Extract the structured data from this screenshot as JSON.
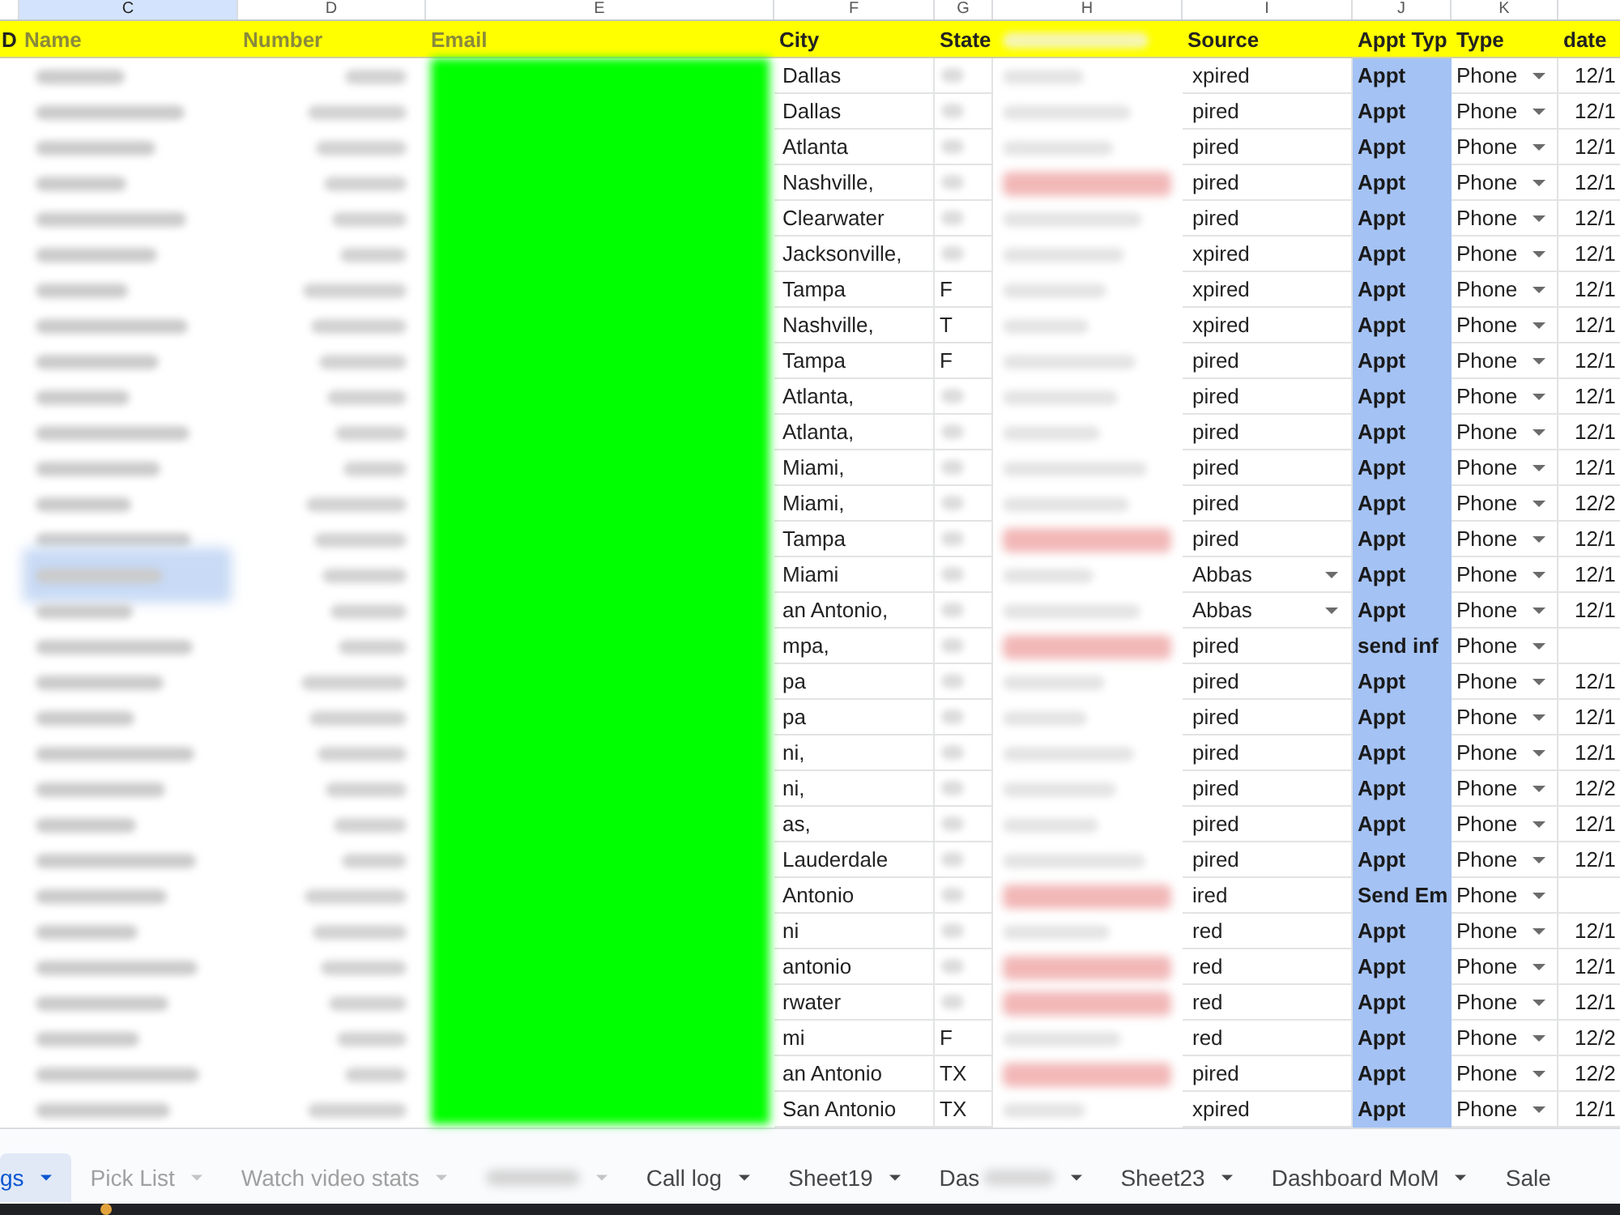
{
  "columns": [
    {
      "letter": "C",
      "selected": true
    },
    {
      "letter": "D",
      "selected": false
    },
    {
      "letter": "E",
      "selected": false
    },
    {
      "letter": "F",
      "selected": false
    },
    {
      "letter": "G",
      "selected": false
    },
    {
      "letter": "H",
      "selected": false
    },
    {
      "letter": "I",
      "selected": false
    },
    {
      "letter": "J",
      "selected": false
    },
    {
      "letter": "K",
      "selected": false
    }
  ],
  "headers": [
    {
      "label": "D",
      "kind": "text"
    },
    {
      "label": "Name",
      "kind": "faded"
    },
    {
      "label": "Number",
      "kind": "faded"
    },
    {
      "label": "Email",
      "kind": "faded"
    },
    {
      "label": "City",
      "kind": "text"
    },
    {
      "label": "State",
      "kind": "text"
    },
    {
      "kind": "redacted"
    },
    {
      "label": "Source",
      "kind": "text"
    },
    {
      "label": "Appt Typ",
      "kind": "text"
    },
    {
      "label": "Type",
      "kind": "text"
    },
    {
      "label": "date",
      "kind": "text"
    }
  ],
  "rows": [
    {
      "selected": false,
      "city": "Dallas",
      "marked": false,
      "source": "xpired",
      "menu": false,
      "appt": "Appt",
      "type": "Phone",
      "date": "12/1"
    },
    {
      "selected": false,
      "city": "Dallas",
      "marked": false,
      "source": "pired",
      "menu": false,
      "appt": "Appt",
      "type": "Phone",
      "date": "12/1"
    },
    {
      "selected": false,
      "city": "Atlanta",
      "marked": false,
      "source": "pired",
      "menu": false,
      "appt": "Appt",
      "type": "Phone",
      "date": "12/1"
    },
    {
      "selected": false,
      "city": "Nashville,",
      "marked": true,
      "source": "pired",
      "menu": false,
      "appt": "Appt",
      "type": "Phone",
      "date": "12/1"
    },
    {
      "selected": false,
      "city": "Clearwater",
      "marked": false,
      "source": "pired",
      "menu": false,
      "appt": "Appt",
      "type": "Phone",
      "date": "12/1"
    },
    {
      "selected": false,
      "city": "Jacksonville,",
      "marked": false,
      "source": "xpired",
      "menu": false,
      "appt": "Appt",
      "type": "Phone",
      "date": "12/1"
    },
    {
      "selected": false,
      "city": "Tampa",
      "state": "F",
      "marked": false,
      "source": "xpired",
      "menu": false,
      "appt": "Appt",
      "type": "Phone",
      "date": "12/1"
    },
    {
      "selected": false,
      "city": "Nashville,",
      "state": "T",
      "marked": false,
      "source": "xpired",
      "menu": false,
      "appt": "Appt",
      "type": "Phone",
      "date": "12/1"
    },
    {
      "selected": false,
      "city": "Tampa",
      "state": "F",
      "marked": false,
      "source": "pired",
      "menu": false,
      "appt": "Appt",
      "type": "Phone",
      "date": "12/1"
    },
    {
      "selected": false,
      "city": "Atlanta,",
      "marked": false,
      "source": "pired",
      "menu": false,
      "appt": "Appt",
      "type": "Phone",
      "date": "12/1"
    },
    {
      "selected": false,
      "city": "Atlanta,",
      "marked": false,
      "source": "pired",
      "menu": false,
      "appt": "Appt",
      "type": "Phone",
      "date": "12/1"
    },
    {
      "selected": false,
      "city": "Miami,",
      "marked": false,
      "source": "pired",
      "menu": false,
      "appt": "Appt",
      "type": "Phone",
      "date": "12/1"
    },
    {
      "selected": false,
      "city": "Miami,",
      "marked": false,
      "source": "pired",
      "menu": false,
      "appt": "Appt",
      "type": "Phone",
      "date": "12/2"
    },
    {
      "selected": false,
      "city": "Tampa",
      "marked": true,
      "source": "pired",
      "menu": false,
      "appt": "Appt",
      "type": "Phone",
      "date": "12/1"
    },
    {
      "selected": true,
      "city": "Miami",
      "marked": false,
      "source": "Abbas",
      "menu": true,
      "appt": "Appt",
      "type": "Phone",
      "date": "12/1"
    },
    {
      "selected": false,
      "city": "an Antonio,",
      "marked": false,
      "source": "Abbas",
      "menu": true,
      "appt": "Appt",
      "type": "Phone",
      "date": "12/1"
    },
    {
      "selected": false,
      "city": "mpa,",
      "marked": true,
      "source": "pired",
      "menu": false,
      "appt": "send inf",
      "type": "Phone"
    },
    {
      "selected": false,
      "city": "pa",
      "marked": false,
      "source": "pired",
      "menu": false,
      "appt": "Appt",
      "type": "Phone",
      "date": "12/1"
    },
    {
      "selected": false,
      "city": "pa",
      "marked": false,
      "source": "pired",
      "menu": false,
      "appt": "Appt",
      "type": "Phone",
      "date": "12/1"
    },
    {
      "selected": false,
      "city": "ni,",
      "marked": false,
      "source": "pired",
      "menu": false,
      "appt": "Appt",
      "type": "Phone",
      "date": "12/1"
    },
    {
      "selected": false,
      "city": "ni,",
      "marked": false,
      "source": "pired",
      "menu": false,
      "appt": "Appt",
      "type": "Phone",
      "date": "12/2"
    },
    {
      "selected": false,
      "city": "as,",
      "marked": false,
      "source": "pired",
      "menu": false,
      "appt": "Appt",
      "type": "Phone",
      "date": "12/1"
    },
    {
      "selected": false,
      "city": "Lauderdale",
      "marked": false,
      "source": "pired",
      "menu": false,
      "appt": "Appt",
      "type": "Phone",
      "date": "12/1"
    },
    {
      "selected": false,
      "city": "Antonio",
      "marked": true,
      "source": "ired",
      "menu": false,
      "appt": "Send Em",
      "type": "Phone"
    },
    {
      "selected": false,
      "city": "ni",
      "marked": false,
      "source": "red",
      "menu": false,
      "appt": "Appt",
      "type": "Phone",
      "date": "12/1"
    },
    {
      "selected": false,
      "city": "antonio",
      "marked": true,
      "source": "red",
      "menu": false,
      "appt": "Appt",
      "type": "Phone",
      "date": "12/1"
    },
    {
      "selected": false,
      "city": "rwater",
      "marked": true,
      "source": "red",
      "menu": false,
      "appt": "Appt",
      "type": "Phone",
      "date": "12/1"
    },
    {
      "selected": false,
      "city": "mi",
      "state": "F",
      "marked": false,
      "source": "red",
      "menu": false,
      "appt": "Appt",
      "type": "Phone",
      "date": "12/2"
    },
    {
      "selected": false,
      "city": "an Antonio",
      "state": "TX",
      "marked": true,
      "source": "pired",
      "menu": false,
      "appt": "Appt",
      "type": "Phone",
      "date": "12/2"
    },
    {
      "selected": false,
      "city": "San Antonio",
      "state": "TX",
      "marked": false,
      "source": "xpired",
      "menu": false,
      "appt": "Appt",
      "type": "Phone",
      "date": "12/1"
    }
  ],
  "sheet_tabs": [
    {
      "label": "gs",
      "kind": "text",
      "selected": true
    },
    {
      "label": "Pick List",
      "kind": "faded",
      "selected": false
    },
    {
      "label": "Watch video stats",
      "kind": "faded",
      "selected": false
    },
    {
      "kind": "redacted",
      "selected": false
    },
    {
      "label": "Call log",
      "kind": "text",
      "selected": false
    },
    {
      "label": "Sheet19",
      "kind": "text",
      "selected": false
    },
    {
      "label": "Das",
      "kind": "partial",
      "selected": false
    },
    {
      "label": "Sheet23",
      "kind": "text",
      "selected": false
    },
    {
      "label": "Dashboard MoM",
      "kind": "text",
      "selected": false
    },
    {
      "label": "Sale",
      "kind": "cut",
      "selected": false
    }
  ]
}
